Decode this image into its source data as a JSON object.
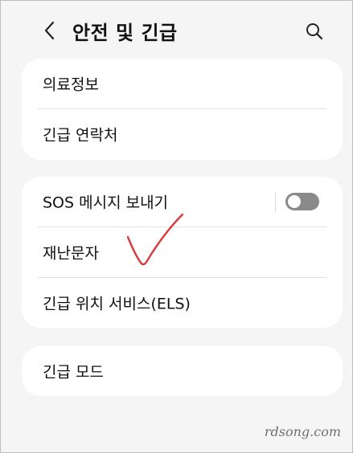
{
  "header": {
    "title": "안전 및 긴급",
    "back_icon": "chevron-left-icon",
    "search_icon": "search-icon"
  },
  "groups": [
    {
      "items": [
        {
          "label": "의료정보"
        },
        {
          "label": "긴급 연락처"
        }
      ]
    },
    {
      "items": [
        {
          "label": "SOS 메시지 보내기",
          "toggle": {
            "on": false
          }
        },
        {
          "label": "재난문자"
        },
        {
          "label": "긴급 위치 서비스(ELS)"
        }
      ]
    },
    {
      "items": [
        {
          "label": "긴급 모드"
        }
      ]
    }
  ],
  "annotation": {
    "icon": "checkmark-icon",
    "color": "#d93a3a"
  },
  "watermark": "rdsong.com",
  "colors": {
    "background": "#f5f5f5",
    "card": "#ffffff",
    "toggle_off": "#8a8a8a"
  }
}
